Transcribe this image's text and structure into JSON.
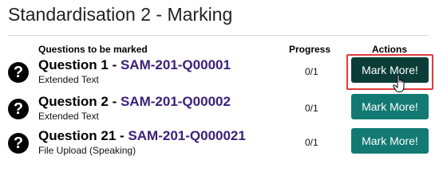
{
  "page": {
    "title": "Standardisation 2 - Marking"
  },
  "table": {
    "headers": {
      "questions": "Questions to be marked",
      "progress": "Progress",
      "actions": "Actions"
    },
    "rows": [
      {
        "label": "Question 1 - ",
        "code": "SAM-201-Q00001",
        "type": "Extended Text",
        "progress": "0/1",
        "action": "Mark More!",
        "status": "hovered"
      },
      {
        "label": "Question 2 - ",
        "code": "SAM-201-Q00002",
        "type": "Extended Text",
        "progress": "0/1",
        "action": "Mark More!"
      },
      {
        "label": "Question 21 - ",
        "code": "SAM-201-Q000021",
        "type": "File Upload (Speaking)",
        "progress": "0/1",
        "action": "Mark More!"
      }
    ]
  },
  "icons": {
    "row_icon": "help-icon",
    "pointer": "hand-pointer-icon"
  },
  "colors": {
    "button": "#127a72",
    "button_hovered": "#0b3d38",
    "code_text": "#3a1f7a",
    "highlight": "#e03a3a"
  }
}
